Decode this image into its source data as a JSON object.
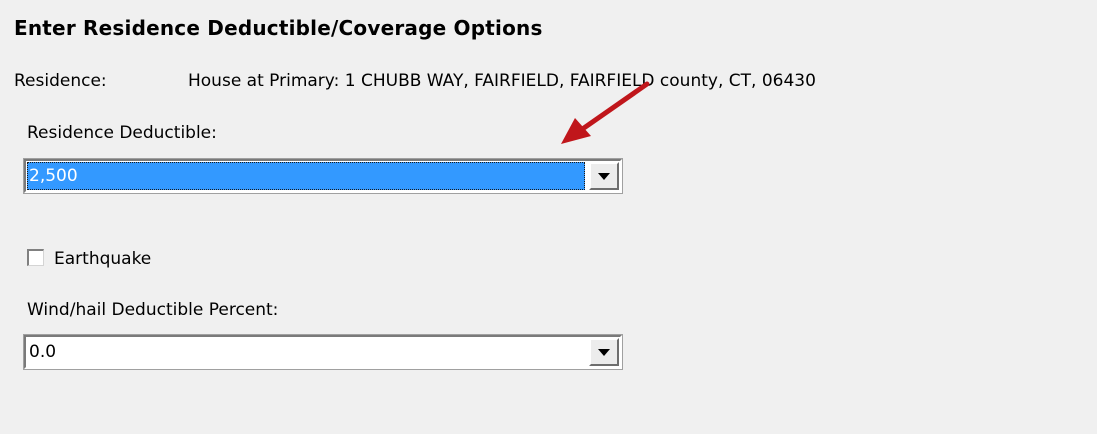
{
  "form": {
    "title": "Enter Residence Deductible/Coverage Options",
    "residence_label": "Residence:",
    "residence_value": "House at Primary: 1 CHUBB WAY, FAIRFIELD, FAIRFIELD county, CT, 06430",
    "deductible_label": "Residence Deductible:",
    "deductible_value": "2,500",
    "earthquake_label": "Earthquake",
    "earthquake_checked": false,
    "windhail_label": "Wind/hail Deductible Percent:",
    "windhail_value": "0.0"
  },
  "icons": {
    "dropdown": "chevron-down-icon",
    "annotation": "red-arrow-icon"
  },
  "colors": {
    "background": "#f0f0f0",
    "selection": "#3399ff",
    "annotation_arrow": "#c0161b"
  }
}
